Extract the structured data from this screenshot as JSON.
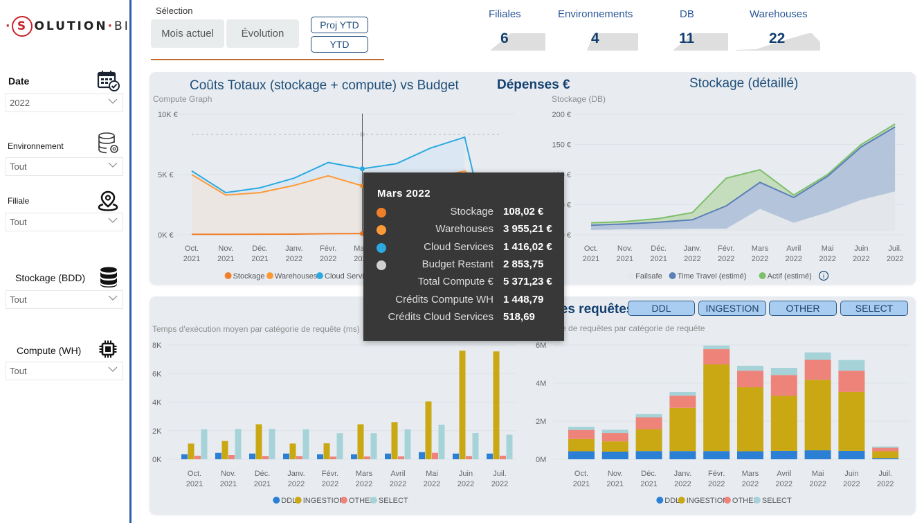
{
  "logo": {
    "s": "S",
    "text": "OLUTION",
    "sep": "·",
    "bi": "BI"
  },
  "sidebar": {
    "slicers": [
      {
        "label": "Date",
        "value": "2022",
        "icon": "calendar-check-icon"
      },
      {
        "label": "Environnement",
        "value": "Tout",
        "icon": "database-gear-icon"
      },
      {
        "label": "Filiale",
        "value": "Tout",
        "icon": "map-pin-icon"
      },
      {
        "label": "Stockage (BDD)",
        "value": "Tout",
        "icon": "database-icon"
      },
      {
        "label": "Compute (WH)",
        "value": "Tout",
        "icon": "cpu-chip-icon"
      }
    ]
  },
  "selection": {
    "label": "Sélection",
    "buttons": [
      "Mois actuel",
      "Évolution"
    ],
    "toggles": [
      "Proj YTD",
      "YTD"
    ]
  },
  "kpis": [
    {
      "title": "Filiales",
      "value": "6"
    },
    {
      "title": "Environnements",
      "value": "4"
    },
    {
      "title": "DB",
      "value": "11"
    },
    {
      "title": "Warehouses",
      "value": "22"
    }
  ],
  "top_panel": {
    "title_left": "Coûts Totaux (stockage + compute) vs Budget",
    "title_center": "Dépenses €",
    "title_right": "Stockage (détaillé)"
  },
  "bottom_panel": {
    "title": "Analyse des requêtes",
    "category_buttons": [
      "DDL",
      "INGESTION",
      "OTHER",
      "SELECT"
    ]
  },
  "tooltip": {
    "title": "Mars 2022",
    "rows": [
      {
        "label": "Stockage",
        "value": "108,02 €",
        "color": "#f07f2a"
      },
      {
        "label": "Warehouses",
        "value": "3 955,21 €",
        "color": "#fd9a38"
      },
      {
        "label": "Cloud Services",
        "value": "1 416,02 €",
        "color": "#2ba9e0"
      },
      {
        "label": "Budget Restant",
        "value": "2 853,75",
        "color": "#d0d0d0"
      },
      {
        "label": "Total Compute €",
        "value": "5 371,23 €"
      },
      {
        "label": "Crédits Compute WH",
        "value": "1 448,79"
      },
      {
        "label": "Crédits Cloud Services",
        "value": "518,69"
      }
    ]
  },
  "chart_data": [
    {
      "id": "compute",
      "type": "area",
      "title": "Compute Graph",
      "categories": [
        "Oct. 2021",
        "Nov. 2021",
        "Déc. 2021",
        "Janv. 2022",
        "Févr. 2022",
        "Mars 2022",
        "Avril 2022",
        "Mai 2022",
        "Juin 2022",
        "Juil. 2022"
      ],
      "yticks": [
        "0K €",
        "5K €",
        "10K €"
      ],
      "ylim": [
        0,
        10000
      ],
      "series": [
        {
          "name": "Stockage",
          "color": "#f07f2a",
          "values": [
            40,
            45,
            50,
            60,
            90,
            108,
            110,
            120,
            130,
            140
          ]
        },
        {
          "name": "Warehouses",
          "color": "#fd9a38",
          "values": [
            5000,
            3300,
            3500,
            4100,
            4900,
            4063,
            4300,
            4700,
            5300,
            null
          ]
        },
        {
          "name": "Cloud Services",
          "color": "#2ba9e0",
          "values": [
            5300,
            3500,
            3900,
            4700,
            6000,
            5479,
            5900,
            7200,
            8100,
            null
          ]
        },
        {
          "name": "Budget Restant",
          "color": "#c8c8c8",
          "values": [
            8333,
            8333,
            8333,
            8333,
            8333,
            8333,
            8333,
            8333,
            8333,
            8333
          ]
        }
      ],
      "hover_category": "Mars 2022",
      "legend": [
        "Stockage",
        "Warehouses",
        "Cloud Services",
        "Budget Restant"
      ],
      "legend_position": "bottom"
    },
    {
      "id": "storage",
      "type": "area",
      "title": "Stockage (DB)",
      "categories": [
        "Oct. 2021",
        "Nov. 2021",
        "Déc. 2021",
        "Janv. 2022",
        "Févr. 2022",
        "Mars 2022",
        "Avril 2022",
        "Mai 2022",
        "Juin 2022",
        "Juil. 2022"
      ],
      "yticks": [
        "0 €",
        "50 €",
        "100 €",
        "150 €",
        "200 €"
      ],
      "ylim": [
        0,
        200
      ],
      "series": [
        {
          "name": "Failsafe",
          "color": "#e6e8ea",
          "values": [
            8,
            9,
            9,
            10,
            10,
            43,
            20,
            37,
            58,
            72
          ]
        },
        {
          "name": "Time Travel (estimé)",
          "color": "#5b7fb8",
          "values": [
            16,
            18,
            21,
            25,
            48,
            87,
            62,
            97,
            146,
            179
          ]
        },
        {
          "name": "Actif (estimé)",
          "color": "#7cbf6a",
          "values": [
            20,
            22,
            27,
            37,
            94,
            108,
            66,
            100,
            150,
            184
          ]
        }
      ],
      "legend": [
        "Failsafe",
        "Time Travel (estimé)",
        "Actif (estimé)"
      ],
      "legend_position": "bottom"
    },
    {
      "id": "exec_time",
      "type": "bar",
      "title": "Temps d'exécution moyen par catégorie de requête (ms)",
      "categories": [
        "Oct. 2021",
        "Nov. 2021",
        "Déc. 2021",
        "Janv. 2022",
        "Févr. 2022",
        "Mars 2022",
        "Avril 2022",
        "Mai 2022",
        "Juin 2022",
        "Juil. 2022"
      ],
      "yticks": [
        "0K",
        "2K",
        "4K",
        "6K",
        "8K"
      ],
      "ylim": [
        0,
        8000
      ],
      "series": [
        {
          "name": "DDL",
          "color": "#2b7fd4",
          "values": [
            350,
            450,
            400,
            400,
            350,
            350,
            400,
            500,
            400,
            400
          ]
        },
        {
          "name": "INGESTION",
          "color": "#c9a813",
          "values": [
            1100,
            1280,
            2450,
            1100,
            1120,
            2450,
            2600,
            4050,
            7600,
            7550
          ]
        },
        {
          "name": "OTHER",
          "color": "#ee837a",
          "values": [
            250,
            290,
            230,
            230,
            190,
            200,
            210,
            450,
            230,
            250
          ]
        },
        {
          "name": "SELECT",
          "color": "#a6d3d8",
          "values": [
            2100,
            2120,
            2130,
            2100,
            1830,
            1830,
            2100,
            2420,
            1840,
            1720
          ]
        }
      ],
      "legend": [
        "DDL",
        "INGESTION",
        "OTHER",
        "SELECT"
      ],
      "legend_position": "bottom"
    },
    {
      "id": "query_count",
      "type": "bar",
      "stacked": true,
      "title": "Nombre de requêtes par catégorie de requête",
      "categories": [
        "Oct. 2021",
        "Nov. 2021",
        "Déc. 2021",
        "Janv. 2022",
        "Févr. 2022",
        "Mars 2022",
        "Avril 2022",
        "Mai 2022",
        "Juin 2022",
        "Juil. 2022"
      ],
      "yticks": [
        "0M",
        "2M",
        "4M",
        "6M"
      ],
      "ylim": [
        0,
        6000000
      ],
      "series": [
        {
          "name": "DDL",
          "color": "#2b7fd4",
          "values": [
            420000,
            400000,
            430000,
            430000,
            430000,
            420000,
            440000,
            470000,
            440000,
            60000
          ]
        },
        {
          "name": "INGESTION",
          "color": "#c9a813",
          "values": [
            640000,
            540000,
            1150000,
            2270000,
            4550000,
            3360000,
            2890000,
            3700000,
            3090000,
            360000
          ]
        },
        {
          "name": "OTHER",
          "color": "#ee837a",
          "values": [
            480000,
            440000,
            620000,
            640000,
            800000,
            870000,
            1090000,
            1050000,
            1120000,
            180000
          ]
        },
        {
          "name": "SELECT",
          "color": "#a6d3d8",
          "values": [
            170000,
            170000,
            170000,
            190000,
            190000,
            260000,
            380000,
            390000,
            560000,
            70000
          ]
        }
      ],
      "legend": [
        "DDL",
        "INGESTION",
        "OTHER",
        "SELECT"
      ],
      "legend_position": "bottom"
    }
  ]
}
